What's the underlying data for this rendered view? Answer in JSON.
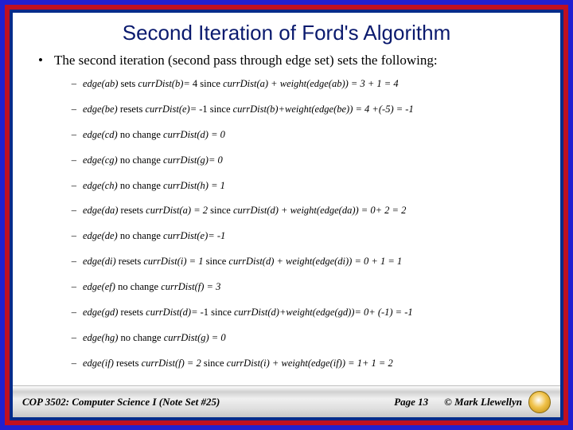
{
  "title": "Second Iteration of Ford's Algorithm",
  "mainBullet": "The second iteration (second pass through edge set) sets the following:",
  "subs": [
    {
      "edge": "edge(ab)",
      "rest": " sets ",
      "var": "currDist(b)=",
      "val": " 4 since ",
      "expr": "currDist(a) + weight(edge(ab)) = 3 + 1 = 4"
    },
    {
      "edge": "edge(be)",
      "rest": " resets ",
      "var": "currDist(e)=",
      "val": " -1 since ",
      "expr": "currDist(b)+weight(edge(be)) = 4 +(-5) = -1"
    },
    {
      "edge": "edge(cd)",
      "rest": " no change ",
      "var": "currDist(d) = 0",
      "val": "",
      "expr": ""
    },
    {
      "edge": "edge(cg)",
      "rest": " no change ",
      "var": "currDist(g)= 0",
      "val": "",
      "expr": ""
    },
    {
      "edge": "edge(ch)",
      "rest": " no change ",
      "var": "currDist(h) = 1",
      "val": "",
      "expr": ""
    },
    {
      "edge": "edge(da)",
      "rest": " resets ",
      "var": "currDist(a) = 2",
      "val": " since ",
      "expr": "currDist(d) + weight(edge(da)) = 0+ 2 = 2"
    },
    {
      "edge": "edge(de)",
      "rest": " no change ",
      "var": "currDist(e)= -1",
      "val": "",
      "expr": ""
    },
    {
      "edge": "edge(di)",
      "rest": " resets ",
      "var": "currDist(i) = 1",
      "val": " since ",
      "expr": "currDist(d) + weight(edge(di)) = 0 + 1 = 1"
    },
    {
      "edge": "edge(ef)",
      "rest": " no change ",
      "var": "currDist(f) = 3",
      "val": "",
      "expr": ""
    },
    {
      "edge": "edge(gd)",
      "rest": " resets ",
      "var": "currDist(d)=",
      "val": " -1 since ",
      "expr": "currDist(d)+weight(edge(gd))= 0+ (-1) = -1"
    },
    {
      "edge": "edge(hg)",
      "rest": " no change ",
      "var": "currDist(g) = 0",
      "val": "",
      "expr": ""
    },
    {
      "edge": "edge(if)",
      "rest": " resets ",
      "var": "currDist(f) = 2",
      "val": " since ",
      "expr": "currDist(i) + weight(edge(if)) = 1+ 1 = 2"
    }
  ],
  "footer": {
    "left": "COP 3502: Computer Science I  (Note Set #25)",
    "mid": "Page 13",
    "right": "© Mark Llewellyn"
  }
}
